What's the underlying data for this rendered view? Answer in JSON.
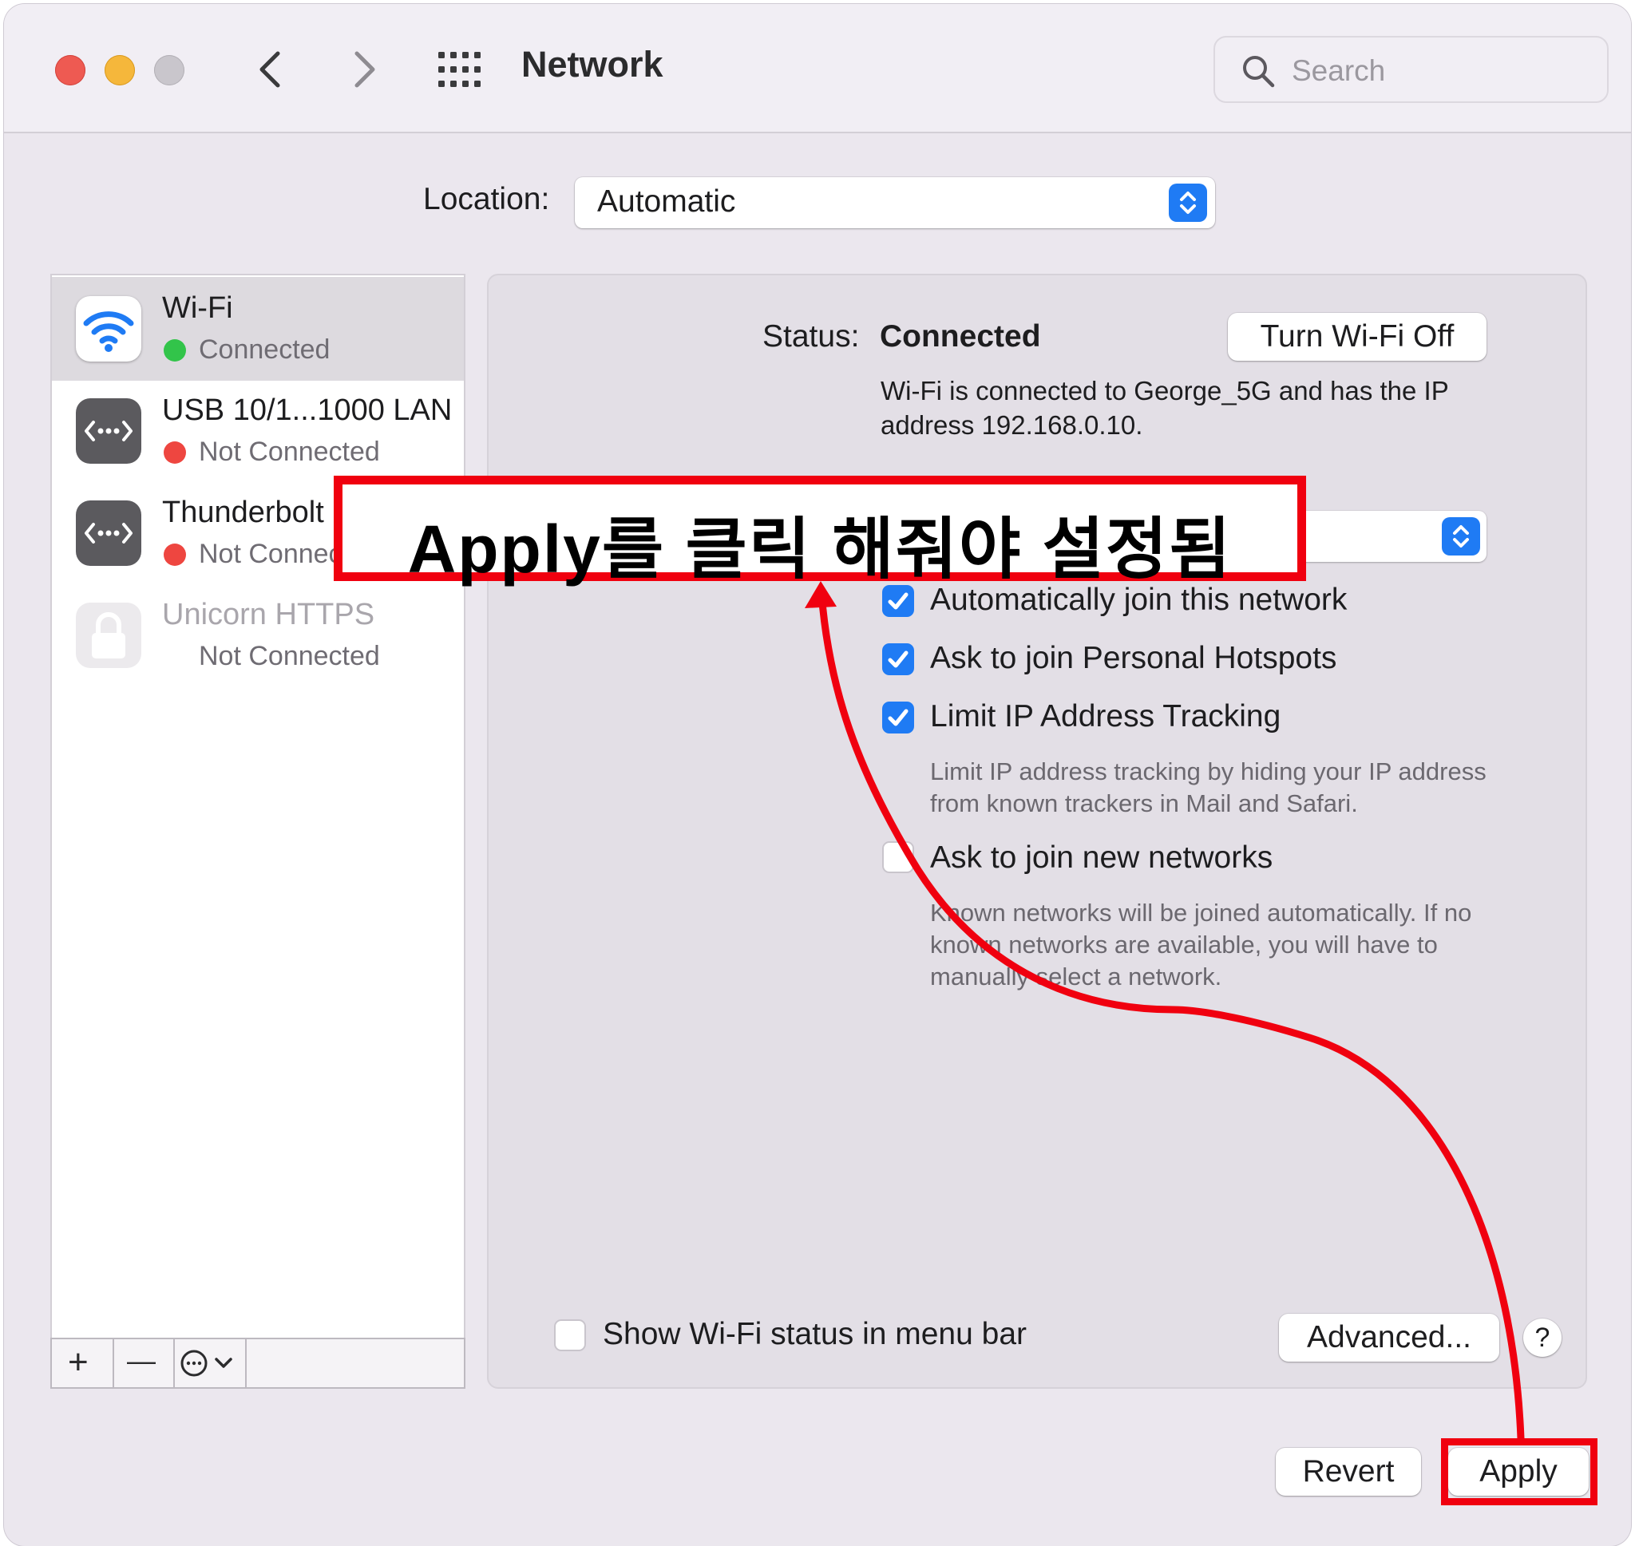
{
  "window": {
    "title": "Network",
    "search_placeholder": "Search"
  },
  "location": {
    "label": "Location:",
    "value": "Automatic"
  },
  "services": [
    {
      "name": "Wi-Fi",
      "status": "Connected",
      "status_color": "#32c44a",
      "icon": "wifi-icon"
    },
    {
      "name": "USB 10/1...1000 LAN",
      "status": "Not Connected",
      "status_color": "#ee4640",
      "icon": "ethernet-icon"
    },
    {
      "name": "Thunderbolt",
      "status": "Not Connected",
      "status_color": "#ee4640",
      "icon": "ethernet-icon"
    },
    {
      "name": "Unicorn HTTPS",
      "status": "Not Connected",
      "icon": "lock-icon"
    }
  ],
  "sidebar_toolbar": {
    "add": "+",
    "remove": "—"
  },
  "detail": {
    "status_label": "Status:",
    "status_value": "Connected",
    "toggle_wifi_label": "Turn Wi-Fi Off",
    "description": "Wi-Fi is connected to George_5G and has the IP address 192.168.0.10.",
    "options": [
      {
        "label": "Automatically join this network",
        "checked": true
      },
      {
        "label": "Ask to join Personal Hotspots",
        "checked": true
      },
      {
        "label": "Limit IP Address Tracking",
        "checked": true
      },
      {
        "label": "Ask to join new networks",
        "checked": false
      }
    ],
    "limit_ip_help": "Limit IP address tracking by hiding your IP address from known trackers in Mail and Safari.",
    "new_networks_help": "Known networks will be joined automatically. If no known networks are available, you will have to manually select a network.",
    "show_status_label": "Show Wi-Fi status in menu bar",
    "show_status_checked": false,
    "advanced_label": "Advanced...",
    "help_label": "?"
  },
  "footer": {
    "revert_label": "Revert",
    "apply_label": "Apply"
  },
  "annotation": {
    "text": "Apply를 클릭 해줘야 설정됨",
    "color": "#f0000f"
  },
  "colors": {
    "accent": "#1f7bf4",
    "window_bg": "#ebe7ee"
  }
}
